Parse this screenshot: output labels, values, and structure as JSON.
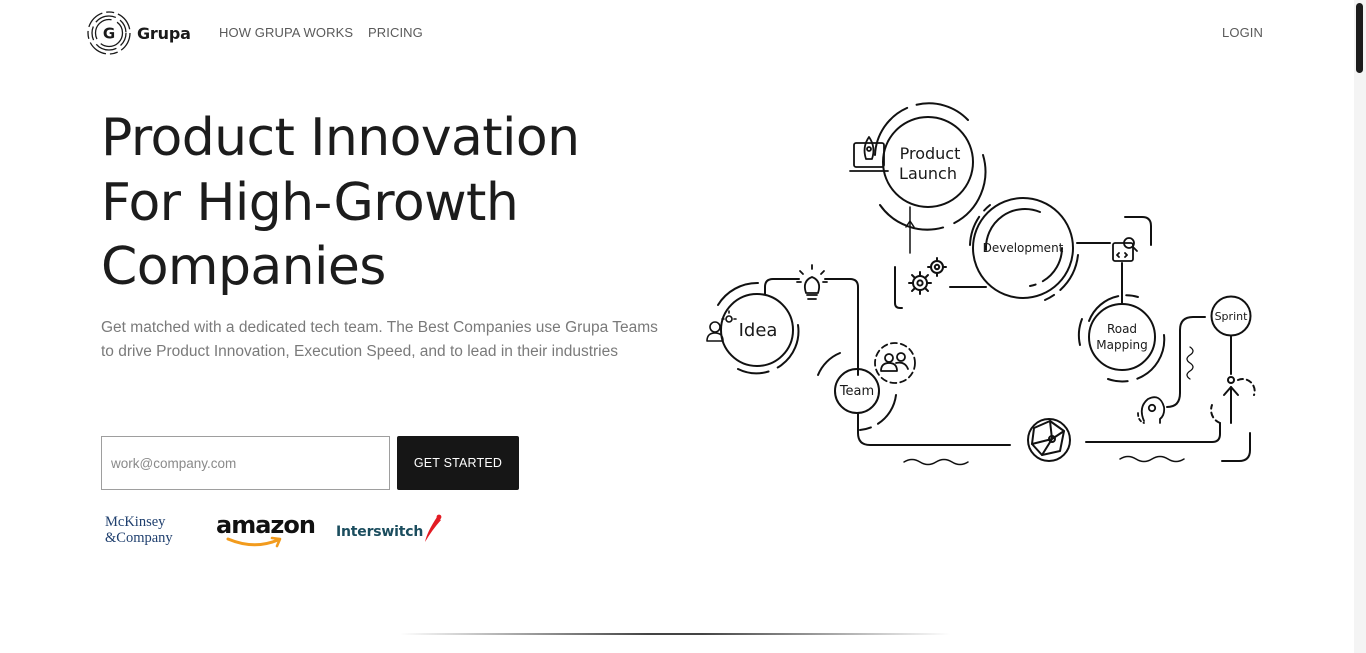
{
  "nav": {
    "brand": "Grupa",
    "brand_initial": "G",
    "links": [
      "HOW GRUPA WORKS",
      "PRICING"
    ],
    "login": "LOGIN"
  },
  "hero": {
    "title_lines": [
      "Product Innovation",
      "For High-Growth",
      "Companies"
    ],
    "subtitle": "Get matched with a dedicated tech team. The Best Companies use Grupa Teams to drive Product Innovation, Execution Speed, and to lead in their industries",
    "email_placeholder": "work@company.com",
    "cta": "GET STARTED"
  },
  "clients": {
    "mckinsey_lines": [
      "McKinsey",
      "&Company"
    ],
    "amazon": "amazon",
    "interswitch": "Interswitch"
  },
  "diagram": {
    "nodes": {
      "product_launch": [
        "Product",
        "Launch"
      ],
      "development": "Development",
      "idea": "Idea",
      "team": "Team",
      "road_mapping": [
        "Road",
        "Mapping"
      ],
      "sprint": "Sprint"
    }
  },
  "colors": {
    "text_dark": "#1c1c1c",
    "text_muted": "#7a7a7a",
    "cta_bg": "#161616",
    "mckinsey": "#1f3f6e",
    "interswitch": "#1b4d5e",
    "interswitch_accent": "#e31b23",
    "amazon_smile": "#f29b1d"
  }
}
